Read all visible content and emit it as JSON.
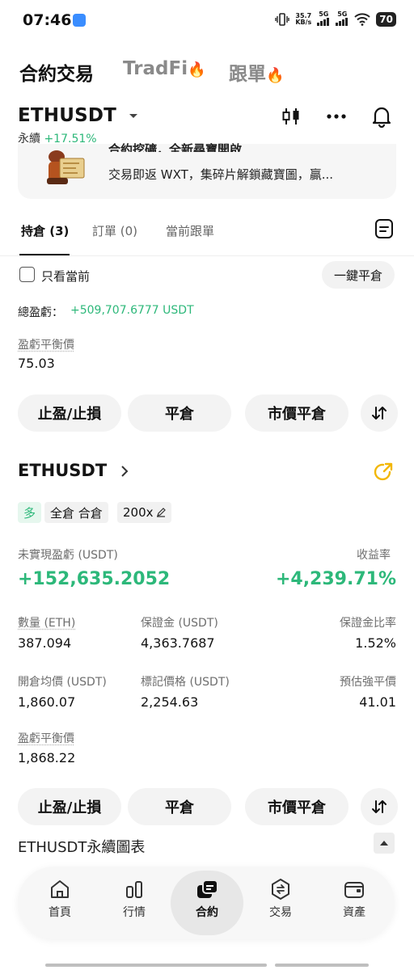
{
  "status_bar": {
    "time": "07:46",
    "net_speed": "35.7",
    "net_unit": "KB/s",
    "sig1": "5G",
    "sig2": "5G",
    "battery": "70"
  },
  "top_tabs": [
    {
      "label": "合約交易"
    },
    {
      "label": "TradFi"
    },
    {
      "label": "跟單"
    }
  ],
  "pair": {
    "symbol": "ETHUSDT",
    "type": "永續",
    "change": "+17.51%"
  },
  "banner": {
    "title": "合約挖礦，全新尋寶開啟",
    "text": "交易即返 WXT，集碎片解鎖藏寶圖，贏..."
  },
  "sub_tabs": [
    {
      "label": "持倉 (3)"
    },
    {
      "label": "訂單 (0)"
    },
    {
      "label": "當前跟單"
    }
  ],
  "filters": {
    "only_current": "只看當前",
    "close_all": "一鍵平倉"
  },
  "summary": {
    "total_pnl_label": "總盈虧：",
    "total_pnl_value": "+509,707.6777 USDT",
    "breakeven_label": "盈虧平衡價",
    "breakeven_value": "75.03"
  },
  "actions": {
    "tpsl": "止盈/止損",
    "close": "平倉",
    "market_close": "市價平倉"
  },
  "position": {
    "symbol": "ETHUSDT",
    "side": "多",
    "margin_mode": "全倉 合倉",
    "leverage": "200x",
    "unrealized_label": "未實現盈虧 (USDT)",
    "unrealized_value": "+152,635.2052",
    "roi_label": "收益率",
    "roi_value": "+4,239.71%",
    "qty_label": "數量 (ETH)",
    "qty_value": "387.094",
    "margin_label": "保證金 (USDT)",
    "margin_value": "4,363.7687",
    "margin_ratio_label": "保證金比率",
    "margin_ratio_value": "1.52%",
    "entry_label": "開倉均價 (USDT)",
    "entry_value": "1,860.07",
    "mark_label": "標記價格 (USDT)",
    "mark_value": "2,254.63",
    "liq_label": "預估強平價",
    "liq_value": "41.01",
    "breakeven_label": "盈虧平衡價",
    "breakeven_value": "1,868.22"
  },
  "chart_section": {
    "title": "ETHUSDT永續圖表"
  },
  "bottom_nav": [
    {
      "label": "首頁",
      "icon": "home-icon"
    },
    {
      "label": "行情",
      "icon": "market-icon"
    },
    {
      "label": "合約",
      "icon": "futures-icon"
    },
    {
      "label": "交易",
      "icon": "trade-icon"
    },
    {
      "label": "資產",
      "icon": "wallet-icon"
    }
  ],
  "colors": {
    "positive": "#2db87a",
    "accent_orange": "#f28b2c",
    "share_icon": "#f2b705"
  }
}
